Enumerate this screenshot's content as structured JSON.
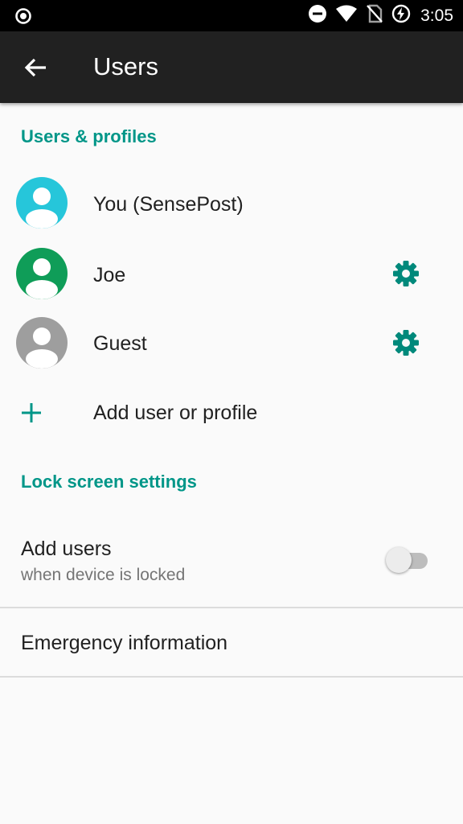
{
  "status_bar": {
    "time": "3:05",
    "icons": [
      "radio-button-icon",
      "do-not-disturb-icon",
      "wifi-icon",
      "no-sim-icon",
      "battery-charging-icon"
    ]
  },
  "app_bar": {
    "title": "Users",
    "back_icon": "arrow-back-icon"
  },
  "users_section": {
    "header": "Users & profiles",
    "items": [
      {
        "label": "You (SensePost)",
        "avatar_color": "#26c6da",
        "has_settings": false
      },
      {
        "label": "Joe",
        "avatar_color": "#0f9d58",
        "has_settings": true
      },
      {
        "label": "Guest",
        "avatar_color": "#9e9e9e",
        "has_settings": true
      }
    ],
    "add_label": "Add user or profile"
  },
  "lock_section": {
    "header": "Lock screen settings",
    "add_users_title": "Add users",
    "add_users_summary": "when device is locked",
    "add_users_enabled": false
  },
  "emergency": {
    "label": "Emergency information"
  },
  "colors": {
    "accent": "#009688",
    "app_bar": "#212121",
    "background": "#fafafa"
  }
}
